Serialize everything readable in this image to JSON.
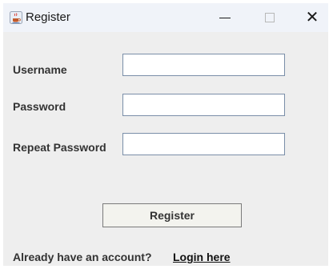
{
  "window": {
    "title": "Register",
    "icon": "java-coffee-cup-icon",
    "controls": {
      "minimize": "minimize-icon",
      "maximize": "maximize-icon",
      "close": "close-icon",
      "close_glyph": "✕"
    }
  },
  "form": {
    "username_label": "Username",
    "username_value": "",
    "password_label": "Password",
    "password_value": "",
    "repeat_password_label": "Repeat Password",
    "repeat_password_value": "",
    "register_button": "Register"
  },
  "footer": {
    "prompt": "Already have an account?",
    "login_link": "Login here"
  },
  "colors": {
    "background": "#eeeeee",
    "titlebar": "#f0f3f9",
    "field_border": "#7a8ea8",
    "text": "#333333"
  }
}
